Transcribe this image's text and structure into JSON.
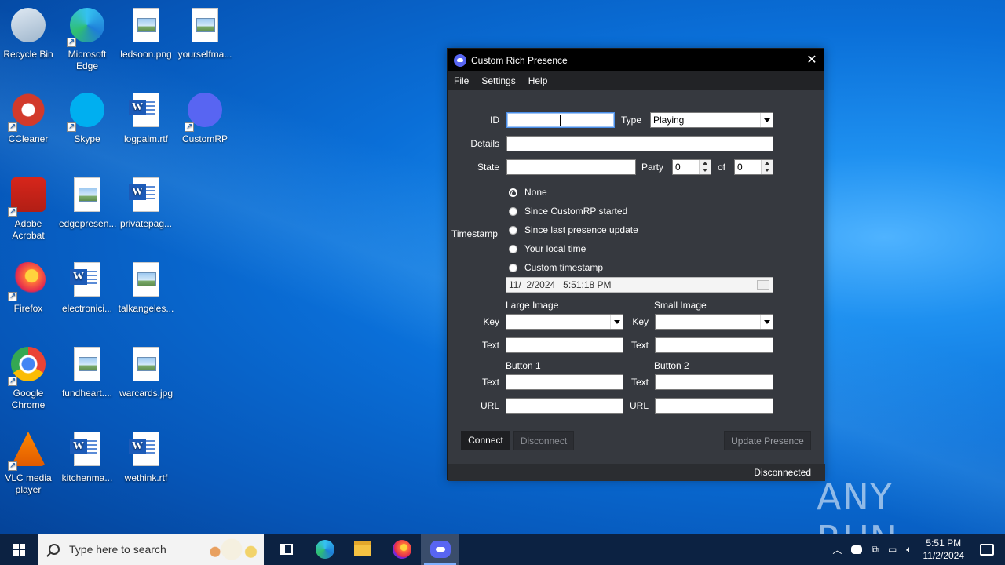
{
  "desktop": {
    "icons": [
      {
        "label": "Recycle Bin",
        "icon": "recycle-bin-icon"
      },
      {
        "label": "Microsoft Edge",
        "icon": "edge-icon"
      },
      {
        "label": "ledsoon.png",
        "icon": "image-file-icon"
      },
      {
        "label": "yourselfma...",
        "icon": "image-file-icon"
      },
      {
        "label": "CCleaner",
        "icon": "ccleaner-icon"
      },
      {
        "label": "Skype",
        "icon": "skype-icon"
      },
      {
        "label": "logpalm.rtf",
        "icon": "word-file-icon"
      },
      {
        "label": "CustomRP",
        "icon": "discord-icon"
      },
      {
        "label": "Adobe Acrobat",
        "icon": "acrobat-icon"
      },
      {
        "label": "edgepresen...",
        "icon": "image-file-icon"
      },
      {
        "label": "privatepag...",
        "icon": "word-file-icon"
      },
      {
        "label": "Firefox",
        "icon": "firefox-icon"
      },
      {
        "label": "electronici...",
        "icon": "word-file-icon"
      },
      {
        "label": "talkangeles...",
        "icon": "image-file-icon"
      },
      {
        "label": "Google Chrome",
        "icon": "chrome-icon"
      },
      {
        "label": "fundheart....",
        "icon": "image-file-icon"
      },
      {
        "label": "warcards.jpg",
        "icon": "image-file-icon"
      },
      {
        "label": "VLC media player",
        "icon": "vlc-icon"
      },
      {
        "label": "kitchenma...",
        "icon": "word-file-icon"
      },
      {
        "label": "wethink.rtf",
        "icon": "word-file-icon"
      }
    ]
  },
  "window": {
    "title": "Custom Rich Presence",
    "menu": [
      "File",
      "Settings",
      "Help"
    ],
    "id_label": "ID",
    "id_value": "",
    "type_label": "Type",
    "type_value": "Playing",
    "details_label": "Details",
    "details_value": "",
    "state_label": "State",
    "state_value": "",
    "party_label": "Party",
    "party_value": "0",
    "of_label": "of",
    "of_value": "0",
    "timestamp_label": "Timestamp",
    "timestamp_options": [
      "None",
      "Since CustomRP started",
      "Since last presence update",
      "Your local time",
      "Custom timestamp"
    ],
    "timestamp_selected": "None",
    "custom_datetime": "11/  2/2024   5:51:18 PM",
    "large_image_label": "Large Image",
    "small_image_label": "Small Image",
    "key_label": "Key",
    "text_label": "Text",
    "button1_label": "Button 1",
    "button2_label": "Button 2",
    "url_label": "URL",
    "connect_label": "Connect",
    "disconnect_label": "Disconnect",
    "update_label": "Update Presence",
    "status": "Disconnected"
  },
  "watermark": "ANY RUN",
  "taskbar": {
    "search_placeholder": "Type here to search",
    "apps": [
      "task-view-icon",
      "edge-icon",
      "file-explorer-icon",
      "firefox-icon",
      "discord-icon"
    ],
    "clock_time": "5:51 PM",
    "clock_date": "11/2/2024"
  }
}
